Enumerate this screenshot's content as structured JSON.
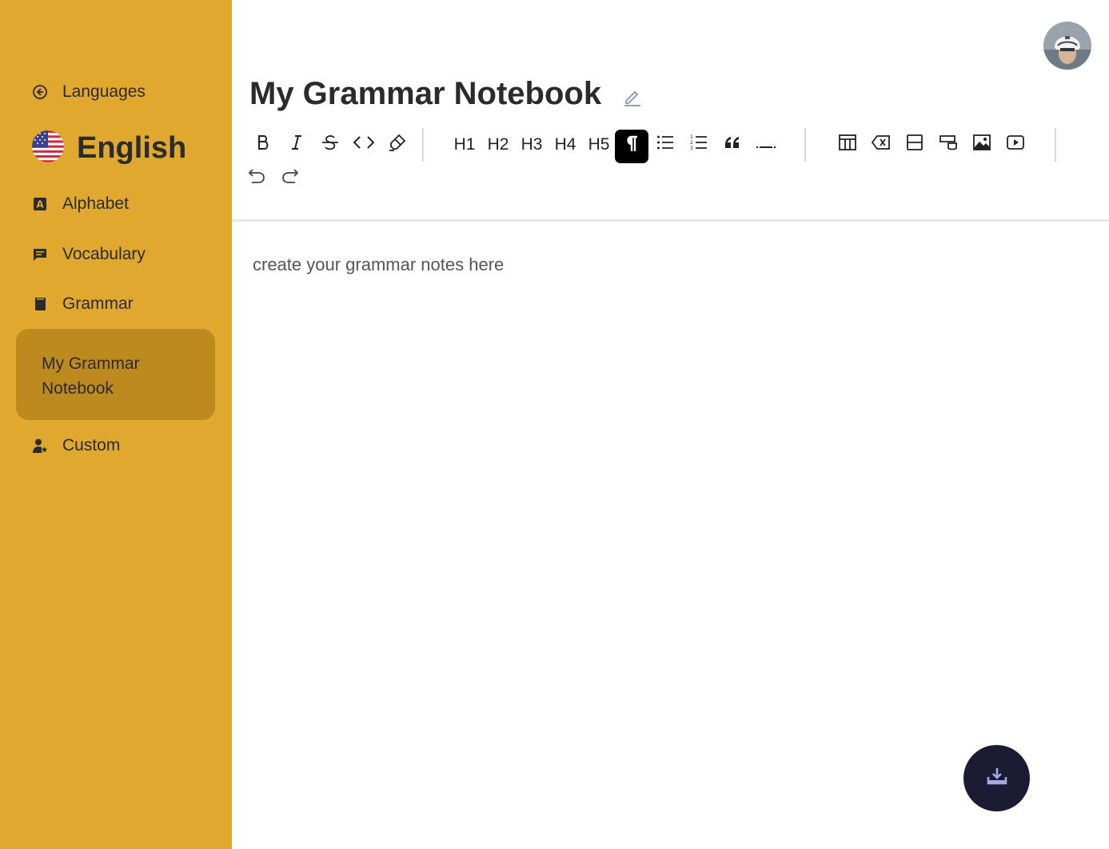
{
  "sidebar": {
    "back_link": {
      "label": "Languages",
      "icon": "arrow-left-circle-icon"
    },
    "language": {
      "name": "English",
      "flag": "us-flag-icon"
    },
    "items": [
      {
        "label": "Alphabet",
        "icon": "alphabet-icon"
      },
      {
        "label": "Vocabulary",
        "icon": "chat-icon"
      },
      {
        "label": "Grammar",
        "icon": "book-icon"
      },
      {
        "label": "My Grammar Notebook",
        "active": true
      },
      {
        "label": "Custom",
        "icon": "user-star-icon"
      }
    ],
    "colors": {
      "background": "#e0a82e",
      "active": "#bc8a1e"
    }
  },
  "header": {
    "title": "My Grammar Notebook",
    "edit_icon": "pencil-icon"
  },
  "toolbar": {
    "headings": [
      "H1",
      "H2",
      "H3",
      "H4",
      "H5"
    ],
    "active_tool": "paragraph",
    "buttons": [
      "bold",
      "italic",
      "strikethrough",
      "code",
      "highlight",
      "h1",
      "h2",
      "h3",
      "h4",
      "h5",
      "paragraph",
      "bullet-list",
      "ordered-list",
      "blockquote",
      "horizontal-rule",
      "insert-table",
      "delete-table",
      "table-row",
      "table-column",
      "image",
      "video",
      "undo",
      "redo"
    ]
  },
  "editor": {
    "placeholder": "create your grammar notes here"
  },
  "fab": {
    "icon": "download-icon",
    "color": "#1c1b34"
  }
}
